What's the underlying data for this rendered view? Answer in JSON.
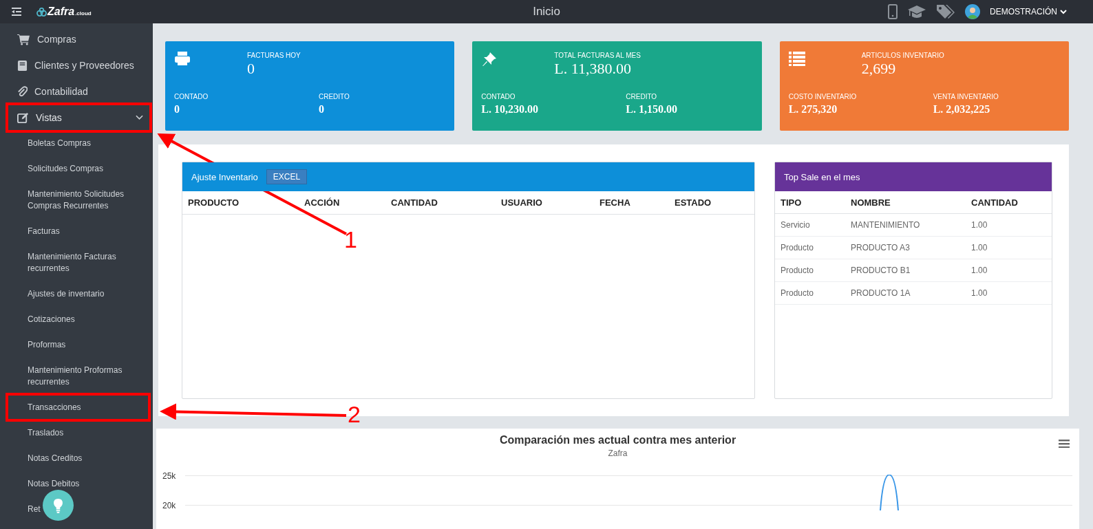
{
  "top_bar": {
    "title": "Inicio",
    "user": "DEMOSTRACIÓN"
  },
  "logo": {
    "name": "Zafra",
    "suffix": ".cloud"
  },
  "sidebar": {
    "items": [
      {
        "label": "Compras"
      },
      {
        "label": "Clientes y Proveedores"
      },
      {
        "label": "Contabilidad"
      },
      {
        "label": "Vistas",
        "expanded": true,
        "children": [
          {
            "label": "Boletas Compras"
          },
          {
            "label": "Solicitudes Compras"
          },
          {
            "label": "Mantenimiento Solicitudes Compras Recurrentes"
          },
          {
            "label": "Facturas"
          },
          {
            "label": "Mantenimiento Facturas recurrentes"
          },
          {
            "label": "Ajustes de inventario"
          },
          {
            "label": "Cotizaciones"
          },
          {
            "label": "Proformas"
          },
          {
            "label": "Mantenimiento Proformas recurrentes"
          },
          {
            "label": "Transacciones"
          },
          {
            "label": "Traslados"
          },
          {
            "label": "Notas Creditos"
          },
          {
            "label": "Notas Debitos"
          },
          {
            "label": "Ret"
          }
        ]
      }
    ]
  },
  "cards": [
    {
      "color": "#0d8fd9",
      "title": "FACTURAS HOY",
      "value": "0",
      "left_label": "CONTADO",
      "left_value": "0",
      "right_label": "CREDITO",
      "right_value": "0"
    },
    {
      "color": "#1aa78a",
      "title": "TOTAL FACTURAS AL MES",
      "value": "L. 11,380.00",
      "left_label": "CONTADO",
      "left_value": "L. 10,230.00",
      "right_label": "CREDITO",
      "right_value": "L. 1,150.00"
    },
    {
      "color": "#f07a37",
      "title": "ARTICULOS INVENTARIO",
      "value": "2,699",
      "left_label": "COSTO INVENTARIO",
      "left_value": "L. 275,320",
      "right_label": "VENTA INVENTARIO",
      "right_value": "L. 2,032,225"
    }
  ],
  "adjustments": {
    "title": "Ajuste Inventario",
    "button": "EXCEL",
    "columns": [
      "PRODUCTO",
      "ACCIÓN",
      "CANTIDAD",
      "USUARIO",
      "FECHA",
      "ESTADO"
    ]
  },
  "top_sale": {
    "title": "Top Sale en el mes",
    "columns": [
      "TIPO",
      "NOMBRE",
      "CANTIDAD"
    ],
    "rows": [
      [
        "Servicio",
        "MANTENIMIENTO",
        "1.00"
      ],
      [
        "Producto",
        "PRODUCTO A3",
        "1.00"
      ],
      [
        "Producto",
        "PRODUCTO B1",
        "1.00"
      ],
      [
        "Producto",
        "PRODUCTO 1A",
        "1.00"
      ]
    ]
  },
  "chart": {
    "title": "Comparación mes actual contra mes anterior",
    "subtitle": "Zafra",
    "y_labels": [
      "25k",
      "20k"
    ]
  },
  "annotations": [
    {
      "label": "1"
    },
    {
      "label": "2"
    }
  ]
}
